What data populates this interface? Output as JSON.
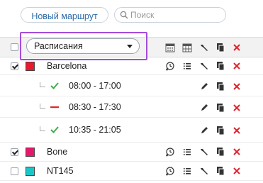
{
  "toolbar": {
    "new_route_label": "Новый маршрут",
    "search_placeholder": "Поиск"
  },
  "header": {
    "filter_value": "Расписания"
  },
  "routes": [
    {
      "name": "Barcelona",
      "color": "#e8192c",
      "checked": true
    },
    {
      "name": "Bone",
      "color": "#e8176b",
      "checked": true
    },
    {
      "name": "NT145",
      "color": "#18c8c8",
      "checked": false
    }
  ],
  "schedules": [
    {
      "time": "08:00 - 17:00",
      "status": "active"
    },
    {
      "time": "08:30 - 17:30",
      "status": "inactive"
    },
    {
      "time": "10:35 - 21:05",
      "status": "active"
    }
  ],
  "colors": {
    "accent": "#2c6aa8",
    "delete": "#e0242d",
    "check_ok": "#3bb04a",
    "highlight": "#a24ddb"
  }
}
